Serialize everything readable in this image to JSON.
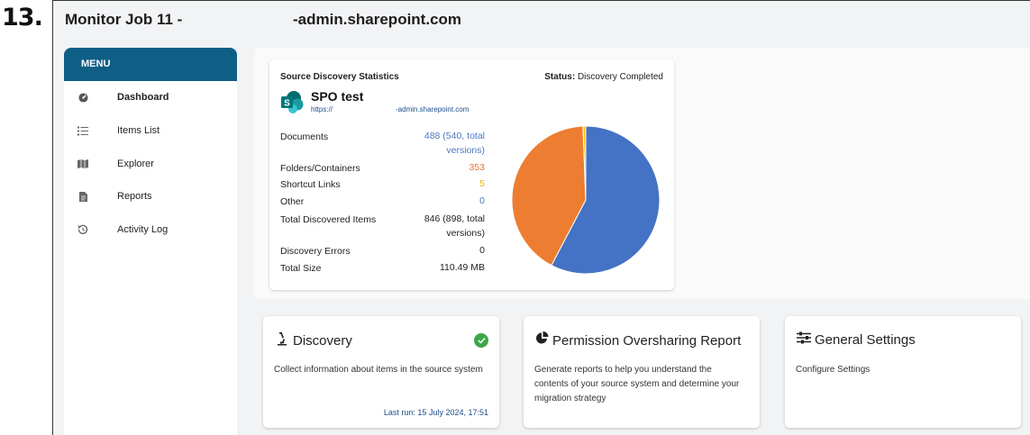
{
  "step_label": "13.",
  "header": {
    "title_left": "Monitor Job 11 -",
    "title_right": "-admin.sharepoint.com"
  },
  "sidebar": {
    "menu_label": "MENU",
    "items": [
      {
        "label": "Dashboard",
        "icon": "dashboard-icon",
        "active": true
      },
      {
        "label": "Items List",
        "icon": "list-icon",
        "active": false
      },
      {
        "label": "Explorer",
        "icon": "map-icon",
        "active": false
      },
      {
        "label": "Reports",
        "icon": "document-icon",
        "active": false
      },
      {
        "label": "Activity Log",
        "icon": "history-icon",
        "active": false
      }
    ]
  },
  "stats": {
    "title": "Source Discovery Statistics",
    "status_label": "Status:",
    "status_value": "Discovery Completed",
    "site_name": "SPO test",
    "site_url_prefix": "https://",
    "site_url_suffix": "-admin.sharepoint.com",
    "rows": [
      {
        "label": "Documents",
        "value": "488 (540, total versions)",
        "color": "#4a78c2"
      },
      {
        "label": "Folders/Containers",
        "value": "353",
        "color": "#e8762d"
      },
      {
        "label": "Shortcut Links",
        "value": "5",
        "color": "#f0b400"
      },
      {
        "label": "Other",
        "value": "0",
        "color": "#4a78c2"
      },
      {
        "label": "Total Discovered Items",
        "value": "846 (898, total versions)",
        "color": "#222222"
      },
      {
        "label": "Discovery Errors",
        "value": "0",
        "color": "#222222"
      },
      {
        "label": "Total Size",
        "value": "110.49 MB",
        "color": "#222222"
      }
    ]
  },
  "chart_data": {
    "type": "pie",
    "categories": [
      "Documents",
      "Folders/Containers",
      "Shortcut Links",
      "Other"
    ],
    "values": [
      488,
      353,
      5,
      0
    ],
    "colors": [
      "#4472c4",
      "#ed7d31",
      "#ffc000",
      "#a5a5a5"
    ]
  },
  "cards": [
    {
      "title": "Discovery",
      "icon": "microscope-icon",
      "description": "Collect information about items in the source system",
      "footer": "Last run: 15 July 2024, 17:51",
      "completed": true
    },
    {
      "title": "Permission Oversharing Report",
      "icon": "pie-chart-icon",
      "description": "Generate reports to help you understand the contents of your source system and determine your migration strategy",
      "footer": "",
      "completed": false
    },
    {
      "title": "General Settings",
      "icon": "sliders-icon",
      "description": "Configure Settings",
      "footer": "",
      "completed": false
    }
  ]
}
